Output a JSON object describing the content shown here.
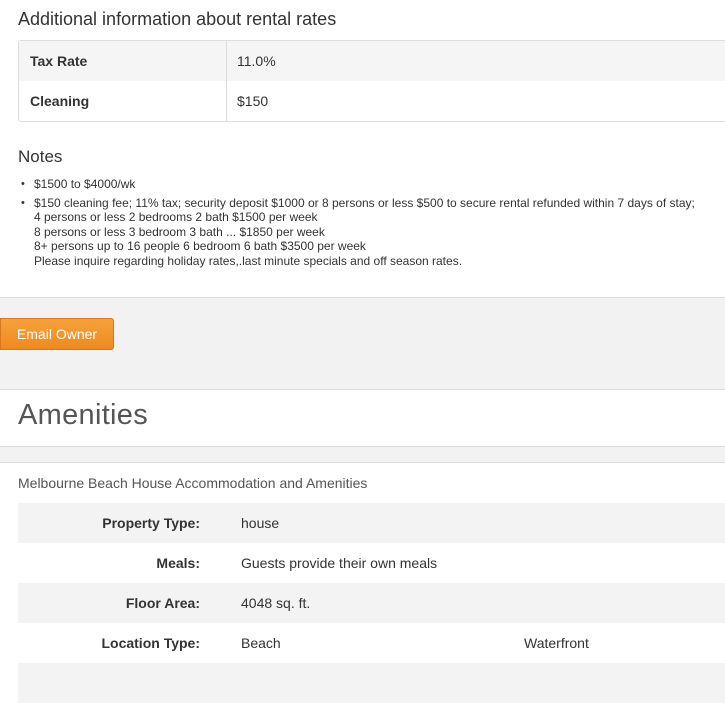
{
  "rates": {
    "title": "Additional information about rental rates",
    "rows": [
      {
        "label": "Tax Rate",
        "value": "11.0%"
      },
      {
        "label": "Cleaning",
        "value": "$150"
      }
    ]
  },
  "notes": {
    "title": "Notes",
    "items": [
      {
        "lines": [
          "$1500 to $4000/wk"
        ]
      },
      {
        "lines": [
          "$150 cleaning fee; 11% tax; security deposit $1000 or 8 persons or less $500 to secure rental refunded within 7 days of stay;",
          "4 persons or less 2 bedrooms 2 bath $1500 per week",
          "8 persons or less 3 bedroom 3 bath ... $1850 per week",
          "8+ persons up to 16 people 6 bedroom 6 bath $3500 per week",
          "Please inquire regarding holiday rates,.last minute specials and off season rates."
        ]
      }
    ]
  },
  "email_button": {
    "label": "Email Owner",
    "color": "#f0901f"
  },
  "amenities": {
    "title": "Amenities",
    "subtitle": "Melbourne Beach House Accommodation and Amenities",
    "rows": [
      {
        "label": "Property Type:",
        "value": "house",
        "value2": ""
      },
      {
        "label": "Meals:",
        "value": "Guests provide their own meals",
        "value2": ""
      },
      {
        "label": "Floor Area:",
        "value": "4048 sq. ft.",
        "value2": ""
      },
      {
        "label": "Location Type:",
        "value": "Beach",
        "value2": "Waterfront"
      },
      {
        "label": "",
        "value": "",
        "value2": ""
      }
    ]
  }
}
